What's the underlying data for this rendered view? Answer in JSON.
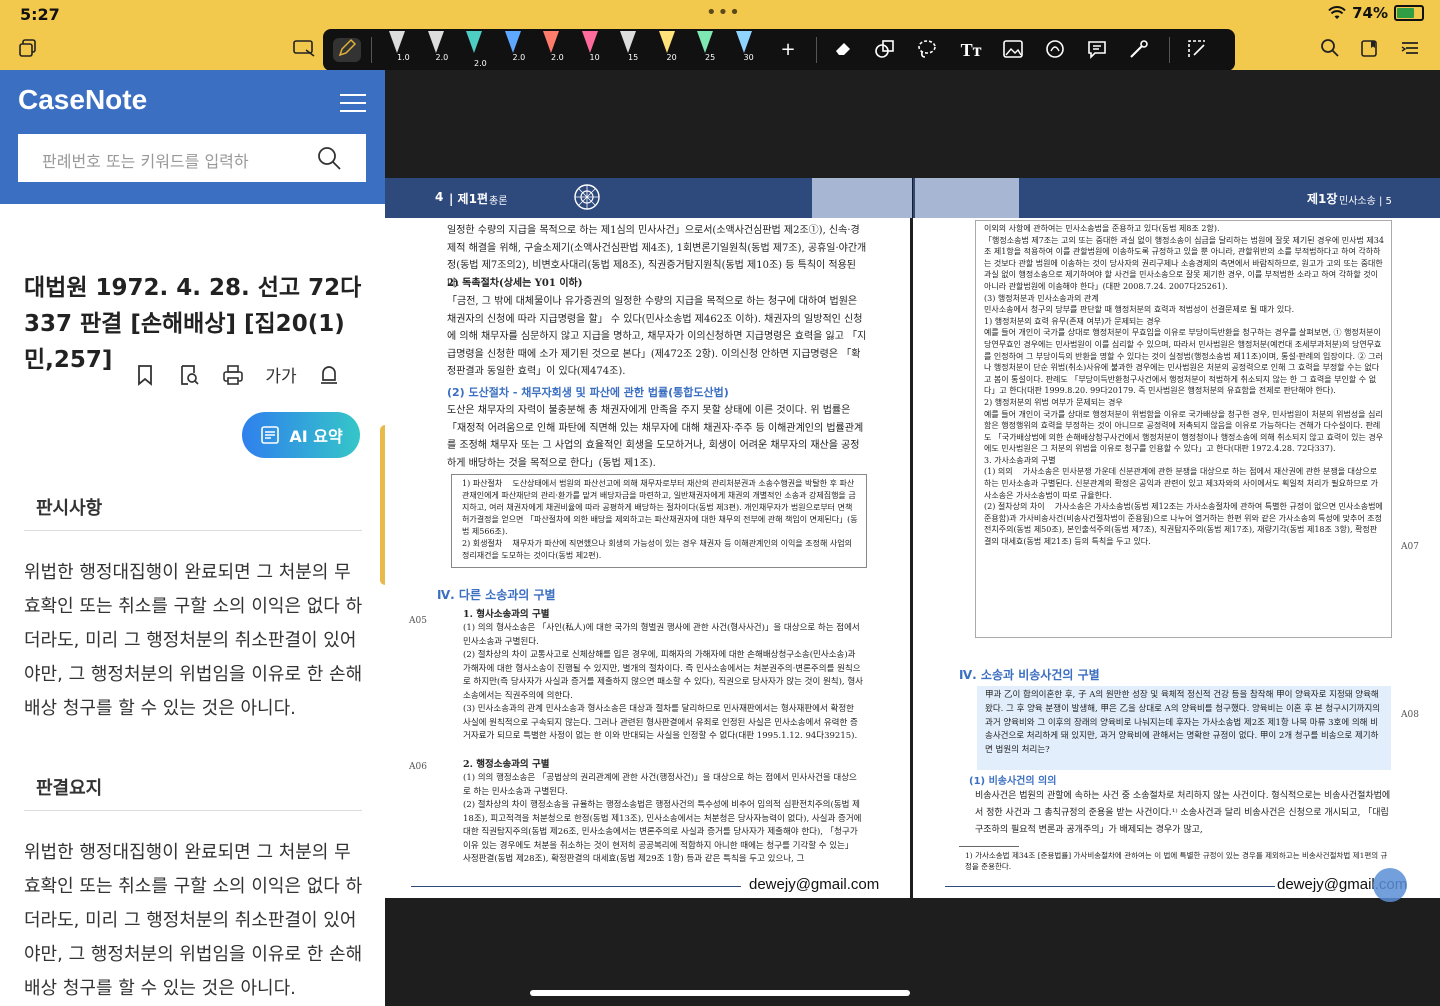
{
  "status": {
    "time": "5:27",
    "dots": "•••",
    "battery": "74%"
  },
  "toolbar": {
    "pens": [
      {
        "label": "1.0",
        "color": "#dddddd"
      },
      {
        "label": "2.0",
        "color": "#dddddd"
      },
      {
        "label": "2.0",
        "color": "#4ecdc4"
      },
      {
        "label": "2.0",
        "color": "#5fa8ff"
      },
      {
        "label": "2.0",
        "color": "#ff7b6b"
      },
      {
        "label": "10",
        "color": "#ff6b9d"
      },
      {
        "label": "15",
        "color": "#dddddd"
      },
      {
        "label": "20",
        "color": "#ffe27a"
      },
      {
        "label": "25",
        "color": "#7ee8b3"
      },
      {
        "label": "30",
        "color": "#8fd3ff"
      }
    ],
    "text_tool": "Tт"
  },
  "sidebar": {
    "brand": "CaseNote",
    "search_placeholder": "판례번호 또는 키워드를 입력하",
    "case_title": "대법원 1972. 4. 28. 선고 72다337 판결 [손해배상] [집20(1)민,257]",
    "font_size_label": "가가",
    "ai_button": "AI 요약",
    "section1_title": "판시사항",
    "section1_body": "위법한 행정대집행이 완료되면 그 처분의 무효확인 또는 취소를 구할 소의 이익은 없다 하더라도, 미리 그 행정처분의 취소판결이 있어야만, 그 행정처분의 위법임을 이유로 한 손해배상 청구를 할 수 있는 것은 아니다.",
    "section2_title": "판결요지",
    "section2_body": "위법한 행정대집행이 완료되면 그 처분의 무효확인 또는 취소를 구할 소의 이익은 없다 하더라도, 미리 그 행정처분의 취소판결이 있어야만, 그 행정처분의 위법임을 이유로 한 손해배상 청구를 할 수 있는 것은 아니다."
  },
  "left_page": {
    "page_no": "4",
    "part": "| 제1편",
    "part_name": "총론",
    "para1": "일정한 수량의 지급을 목적으로 하는 제1심의 민사사건」으로서(소액사건심판법 제2조①), 신속·경제적 해결을 위해, 구술소제기(소액사건심판법 제4조), 1회변론기일원칙(동법 제7조), 공휴일·야간개정(동법 제7조의2), 비변호사대리(동법 제8조), 직권증거탐지원칙(동법 제10조) 등 특칙이 적용된다.",
    "item2": "2) 독촉절차(상세는 Y01 이하)",
    "para2": "「금전, 그 밖에 대체물이나 유가증권의 일정한 수량의 지급을 목적으로 하는 청구에 대하여 법원은 채권자의 신청에 따라 지급명령을 할」 수 있다(민사소송법 제462조 이하). 채권자의 일방적인 신청에 의해 채무자를 심문하지 않고 지급을 명하고, 채무자가 이의신청하면 지급명령은 효력을 잃고 「지급명령을 신청한 때에 소가 제기된 것으로 본다」(제472조 2항). 이의신청 안하면 지급명령은 「확정판결과 동일한 효력」이 있다(제474조).",
    "sub2": "(2) 도산절차 - 채무자회생 및 파산에 관한 법률(통합도산법)",
    "para3": "도산은 채무자의 자력이 불충분해 총 채권자에게 만족을 주지 못할 상태에 이른 것이다. 위 법률은 「재정적 어려움으로 인해 파탄에 직면해 있는 채무자에 대해 채권자·주주 등 이해관계인의 법률관계를 조정해 채무자 또는 그 사업의 효율적인 회생을 도모하거나, 회생이 어려운 채무자의 재산을 공정하게 배당하는 것을 목적으로 한다」(동법 제1조).",
    "box1": "1) 파산절차    도산상태에서 법원의 파산선고에 의해 채무자로부터 재산의 관리처분권과 소송수행권을 박탈한 후 파산관재인에게 파산재단의 관리·환가를 맡겨 배당자금을 마련하고, 일반채권자에게 채권의 개별적인 소송과 강제집행을 금지하고, 여러 채권자에게 채권비율에 따라 공평하게 배당하는 절차이다(동법 제3편). 개인채무자가 법원으로부터 면책허가결정을 얻으면 「파산절차에 의한 배당을 제외하고는 파산채권자에 대한 채무의 전부에 관해 책임이 면제된다」(동법 제566조).\n2) 회생절차    채무자가 파산에 직면했으나 회생의 가능성이 있는 경우 채권자 등 이해관계인의 이익을 조정해 사업의 정리재건을 도모하는 것이다(동법 제2편).",
    "section4": "Ⅳ. 다른 소송과의 구별",
    "m1": "A05",
    "m2": "A06",
    "h1": "1. 형사소송과의 구별",
    "p41": "(1) 의의    형사소송은 「사인(私人)에 대한 국가의 형벌권 행사에 관한 사건(형사사건)」을 대상으로 하는 점에서 민사소송과 구별된다.",
    "p42": "(2) 절차상의 차이    교통사고로 신체상해를 입은 경우에, 피해자의 가해자에 대한 손해배상청구소송(민사소송)과 가해자에 대한 형사소송이 진행될 수 있지만, 별개의 절차이다. 즉 민사소송에서는 처분권주의·변론주의를 원칙으로 하지만(즉 당사자가 사실과 증거를 제출하지 않으면 패소할 수 있다), 직권으로 당사자가 앉는 것이 원칙), 형사소송에서는 직권주의에 의한다.",
    "p43": "(3) 민사소송과의 관계    민사소송과 형사소송은 대상과 절차를 달리하므로 민사재판에서는 형사재판에서 확정한 사실에 원칙적으로 구속되지 않는다. 그러나 관련된 형사판결에서 유죄로 인정된 사실은 민사소송에서 유력한 증거자료가 되므로 특별한 사정이 없는 한 이와 반대되는 사실을 인정할 수 없다(대판 1995.1.12. 94다39215).",
    "h2": "2. 행정소송과의 구별",
    "p51": "(1) 의의    행정소송은 「공법상의 권리관계에 관한 사건(행정사건)」을 대상으로 하는 점에서 민사사건을 대상으로 하는 민사소송과 구별된다.",
    "p52": "(2) 절차상의 차이    행정소송을 규율하는 행정소송법은 행정사건의 특수성에 비추어 임의적 심판전치주의(동법 제18조), 피고적격을 처분청으로 한정(동법 제13조), 민사소송에서는 처분청은 당사자능력이 없다), 사실과 증거에 대한 직권탐지주의(동법 제26조, 민사소송에서는 변론주의로 사실과 증거를 당사자가 제출해야 한다), 「청구가 이유 있는 경우에도 처분을 취소하는 것이 현저히 공공복리에 적합하지 아니한 때에는 청구를 기각할 수 있는」 사정판결(동법 제28조), 확정판결의 대세효(동법 제29조 1항) 등과 같은 특칙을 두고 있으나, 그",
    "email": "dewejy@gmail.com"
  },
  "right_page": {
    "chapter": "제1장",
    "chapter_name": "민사소송 | 5",
    "box_top": "이외의 사항에 관하여는 민사소송법을 준용하고 있다(동법 제8조 2항).\n「행정소송법 제7조는 고의 또는 중대한 과실 없이 행정소송이 심급을 달리하는 법원에 잘못 제기된 경우에 민사법 제34조 제1항을 적용하여 이를 관할법원에 이송하도록 규정하고 있을 뿐 아니라, 관할위반의 소를 부적법하다고 하여 각하하는 것보다 관할 법원에 이송하는 것이 당사자의 권리구제나 소송경제의 측면에서 바람직하므로, 원고가 고의 또는 중대한 과실 없이 행정소송으로 제기하여야 할 사건을 민사소송으로 잘못 제기한 경우, 이를 부적법한 소라고 하여 각하할 것이 아니라 관할법원에 이송해야 한다」(대판 2008.7.24. 2007다25261).\n(3) 행정처분과 민사소송과의 관계\n민사소송에서 청구의 당부를 판단할 때 행정처분의 효력과 적법성이 선결문제로 될 때가 있다.\n1) 행정처분의 효력 유무(존재 여부)가 문제되는 경우\n예를 들어 개인이 국가를 상대로 행정처분이 무효임을 이유로 부당이득반환을 청구하는 경우를 살펴보면, ① 행정처분이 당연무효인 경우에는 민사법원이 이를 심리할 수 있으며, 따라서 민사법원은 행정처분(예컨대 조세부과처분)의 당연무효를 인정하여 그 부당이득의 반환을 명할 수 있다는 것이 실정법(행정소송법 제11조)이며, 통설·판례의 입장이다. ② 그러나 행정처분이 단순 위법(취소)사유에 불과한 경우에는 민사법원은 처분의 공정력으로 인해 그 효력을 부정할 수는 없다고 봄이 통설이다. 판례도 「부당이득반환청구사건에서 행정처분이 적법하게 취소되지 않는 한 그 효력을 부인할 수 없다」고 한다(대판 1999.8.20. 99다20179. 즉 민사법원은 행정처분의 유효함을 전제로 판단해야 한다).\n2) 행정처분의 위법 여부가 문제되는 경우\n예를 들어 개인이 국가를 상대로 행정처분이 위법함을 이유로 국가배상을 청구한 경우, 민사법원이 처분의 위법성을 심리함은 행정행위의 효력을 부정하는 것이 아니므로 공정력에 저촉되지 않음을 이유로 가능하다는 견해가 다수설이다. 판례도 「국가배상법에 의한 손해배상청구사건에서 행정처분이 행정청이나 행정소송에 의해 취소되지 않고 효력이 있는 경우에도 민사법원은 그 처분의 위법을 이유로 청구를 인용할 수 있다」고 한다(대판 1972.4.28. 72다337).\n3. 가사소송과의 구별\n(1) 의의    가사소송은 민사분쟁 가운데 신분관계에 관한 분쟁을 대상으로 하는 점에서 재산권에 관한 분쟁을 대상으로 하는 민사소송과 구별된다. 신분관계의 확정은 공익과 관련이 있고 제3자와의 사이에서도 획일적 처리가 필요하므로 가사소송은 가사소송법이 따로 규율한다.\n(2) 절차상의 차이    가사소송은 가사소송법(동법 제12조는 가사소송절차에 관하여 특별한 규정이 없으면 민사소송법에 준용함)과 가사비송사건(비송사건절차법이 준용됨)으로 나누어 열거하는 한편 위와 같은 가사소송의 특성에 맞추어 조정전치주의(동법 제50조), 본인출석주의(동법 제7조), 직권탐지주의(동법 제17조), 재량기각(동법 제18조 3항), 확정판결의 대세효(동법 제21조) 등의 특칙을 두고 있다.",
    "m1": "A07",
    "m2": "A08",
    "section4": "Ⅳ. 소송과 비송사건의 구별",
    "qbox": "甲과 乙이 합의이혼한 후, 子 A의 원만한 성장 및 육체적 정신적 건강 등을 참작해 甲이 양육자로 지정돼 양육해 왔다. 그 후 양육 분쟁이 발생해, 甲은 乙을 상대로 A의 양육비를 청구했다. 양육비는 이혼 후 본 청구시기까지의 과거 양육비와 그 이후의 장래의 양육비로 나눠지는데 후자는 가사소송법 제2조 제1항 나목 마류 3호에 의해 비송사건으로 처리하게 돼 있지만, 과거 양육비에 관해서는 명확한 규정이 없다. 甲이 2개 청구를 비송으로 제기하면 법원의 처리는?",
    "sub1": "(1) 비송사건의 의의",
    "para1": "비송사건은 법원의 관할에 속하는 사건 중 소송절차로 처리하지 않는 사건이다. 형식적으로는 비송사건절차법에서 정한 사건과 그 총칙규정의 준용을 받는 사건이다.¹⁾ 소송사건과 달리 비송사건은 신청으로 개시되고, 「대립구조하의 필요적 변론과 공개주의」가 배제되는 경우가 많고,",
    "footnote": "1) 가사소송법 제34조 [준용법률] 가사비송절차에 관하여는 이 법에 특별한 규정이 있는 경우를 제외하고는 비송사건절차법 제1편의 규정을 준용한다.",
    "email": "dewejy@gmail.com"
  }
}
